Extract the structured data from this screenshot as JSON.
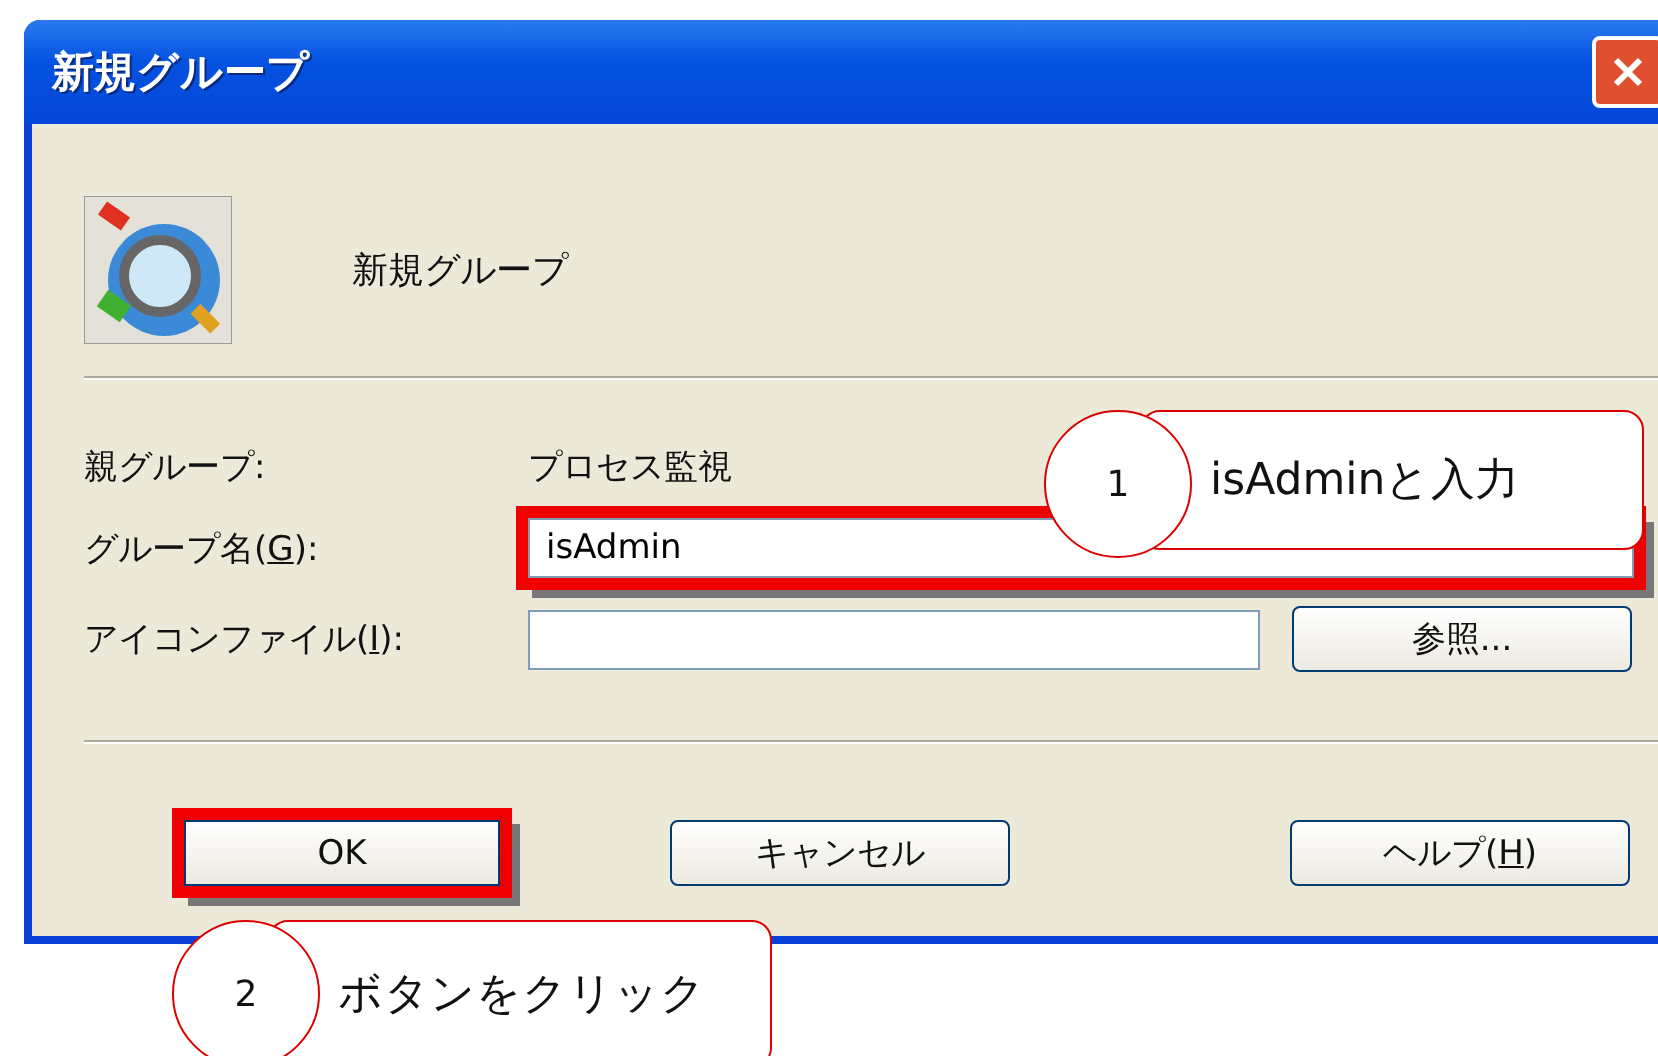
{
  "window": {
    "title": "新規グループ"
  },
  "header": {
    "title": "新規グループ"
  },
  "fields": [
    {
      "kind": "text",
      "label_parts": [
        "親グループ:"
      ],
      "value": "プロセス監視"
    },
    {
      "kind": "input",
      "label_parts": [
        "グループ名(",
        "G",
        "):"
      ],
      "value": "isAdmin",
      "highlighted": true
    },
    {
      "kind": "input_browse",
      "label_parts": [
        "アイコンファイル(",
        "I",
        "):"
      ],
      "button": "参照..."
    }
  ],
  "buttons": [
    {
      "label_parts": [
        "OK"
      ],
      "highlighted": true
    },
    {
      "label_parts": [
        "キャンセル"
      ],
      "highlighted": false
    },
    {
      "label_parts": [
        "ヘルプ(",
        "H",
        ")"
      ],
      "highlighted": false
    }
  ],
  "annotations": [
    {
      "number": "1",
      "text": "isAdminと入力"
    },
    {
      "number": "2",
      "text": "ボタンをクリック"
    }
  ]
}
